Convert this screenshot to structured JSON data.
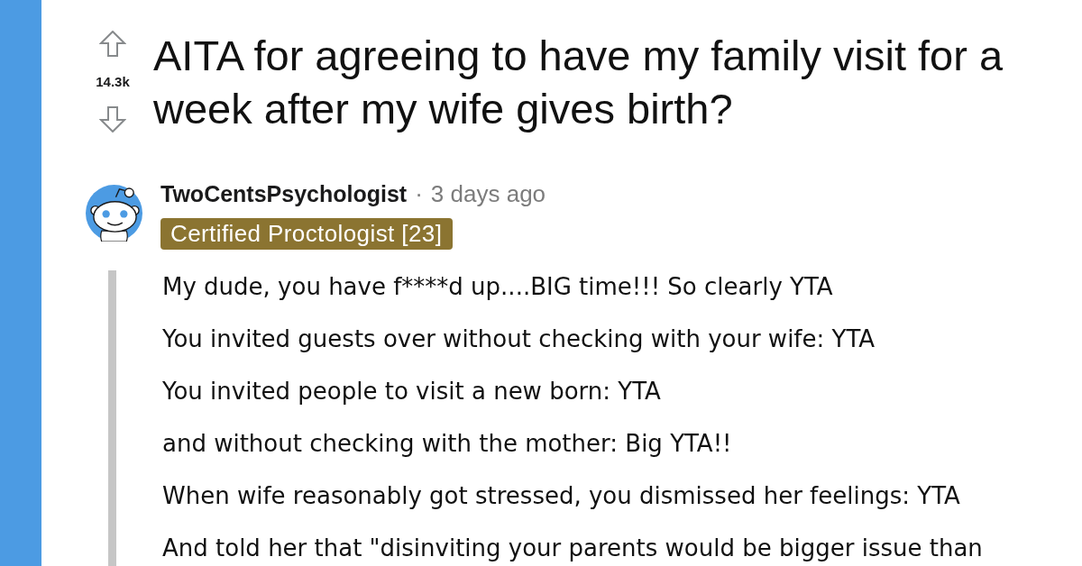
{
  "post": {
    "score": "14.3k",
    "title": "AITA for agreeing to have my family visit for a week after my wife gives birth?"
  },
  "comment": {
    "author": "TwoCentsPsychologist",
    "separator": "·",
    "time": "3 days ago",
    "flair": "Certified Proctologist [23]",
    "paragraphs": [
      "My dude, you have f****d up....BIG time!!! So clearly YTA",
      "You invited guests over without checking with your wife: YTA",
      "You invited people to visit a new born: YTA",
      "and without checking with the mother: Big YTA!!",
      "When wife reasonably got stressed, you dismissed her feelings: YTA",
      "And told her that \"disinviting your parents would be bigger issue than"
    ]
  }
}
